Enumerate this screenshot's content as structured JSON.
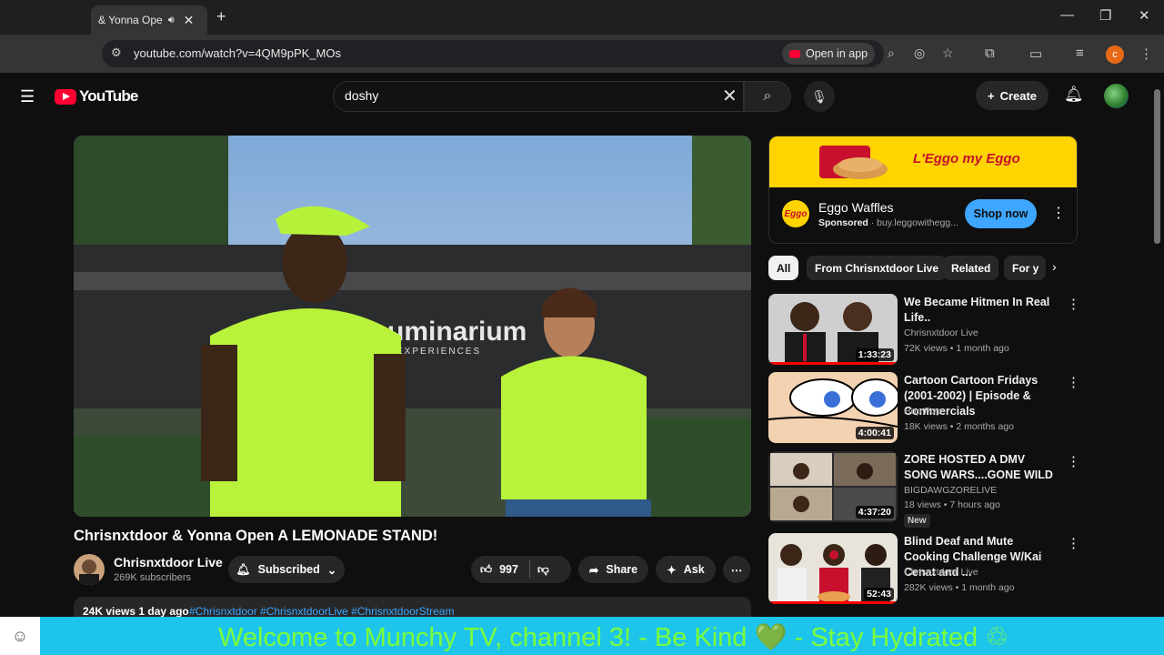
{
  "browser": {
    "tab_title": "& Yonna Ope",
    "url": "youtube.com/watch?v=4QM9pPK_MOs",
    "open_in_app": "Open in app",
    "profile_initial": "c"
  },
  "header": {
    "logo_text": "YouTube",
    "search_value": "doshy",
    "create_label": "Create"
  },
  "video": {
    "title": "Chrisnxtdoor & Yonna Open A LEMONADE STAND!",
    "channel": "Chrisnxtdoor Live",
    "subscribers": "269K subscribers",
    "subscribed_label": "Subscribed",
    "likes": "997",
    "share_label": "Share",
    "ask_label": "Ask",
    "views_date": "24K views  1 day ago",
    "hashtags": "#Chrisnxtdoor #ChrisnxtdoorLive #ChrisnxtdoorStream",
    "sign_text": "uminarium",
    "sign_sub": "EXPERIENCES"
  },
  "ad": {
    "tagline": "L'Eggo my Eggo",
    "logo_text": "Eggo",
    "name": "Eggo Waffles",
    "sponsored": "Sponsored",
    "domain": "· buy.leggowithegg...",
    "cta": "Shop now"
  },
  "chips": [
    "All",
    "From Chrisnxtdoor Live",
    "Related",
    "For y"
  ],
  "recommendations": [
    {
      "title": "We Became Hitmen In Real Life..",
      "channel": "Chrisnxtdoor Live",
      "meta": "72K views • 1 month ago",
      "duration": "1:33:23",
      "progress": 1.0
    },
    {
      "title": "Cartoon Cartoon Fridays (2001-2002) | Episode & Commercials",
      "channel": "Hop Pop",
      "meta": "18K views • 2 months ago",
      "duration": "4:00:41",
      "progress": 0
    },
    {
      "title": "ZORE HOSTED A DMV SONG WARS....GONE WILD",
      "channel": "BIGDAWGZORELIVE",
      "meta": "18 views • 7 hours ago",
      "duration": "4:37:20",
      "badge": "New",
      "progress": 0
    },
    {
      "title": "Blind Deaf and Mute Cooking Challenge W/Kai Cenat and ...",
      "channel": "Chrisnxtdoor Live",
      "meta": "282K views • 1 month ago",
      "duration": "52:43",
      "progress": 1.0
    }
  ],
  "ticker": {
    "text": "Welcome to Munchy TV, channel 3!  - Be Kind 💚 - Stay Hydrated "
  },
  "colors": {
    "accent_red": "#ff0033",
    "cta_blue": "#3ea6ff",
    "ticker_bg": "#1ec5ea",
    "ticker_text": "#7cff3a",
    "ad_yellow": "#ffd400"
  }
}
